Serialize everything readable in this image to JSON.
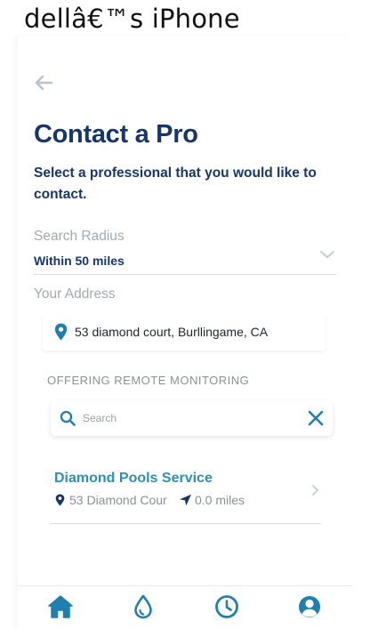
{
  "status_bar": {
    "device_name": "dellâ€™s iPhone"
  },
  "header": {
    "title": "Contact a Pro",
    "subtitle": "Select a professional that you would like to contact."
  },
  "form": {
    "radius_label": "Search Radius",
    "radius_value": "Within 50 miles",
    "address_label": "Your Address",
    "address_value": "53 diamond court, Burllingame, CA"
  },
  "results": {
    "section_heading": "OFFERING REMOTE MONITORING",
    "search_placeholder": "Search",
    "pros": [
      {
        "name": "Diamond Pools Service",
        "address": "53 Diamond Cour",
        "distance": "0.0 miles"
      }
    ]
  },
  "tab_bar": {
    "tabs": [
      "home",
      "water",
      "history",
      "profile"
    ]
  },
  "colors": {
    "primary_navy": "#17376b",
    "accent_blue": "#1f7fb1",
    "link_teal": "#2d8fb6",
    "muted_gray": "#a2a9b4"
  }
}
